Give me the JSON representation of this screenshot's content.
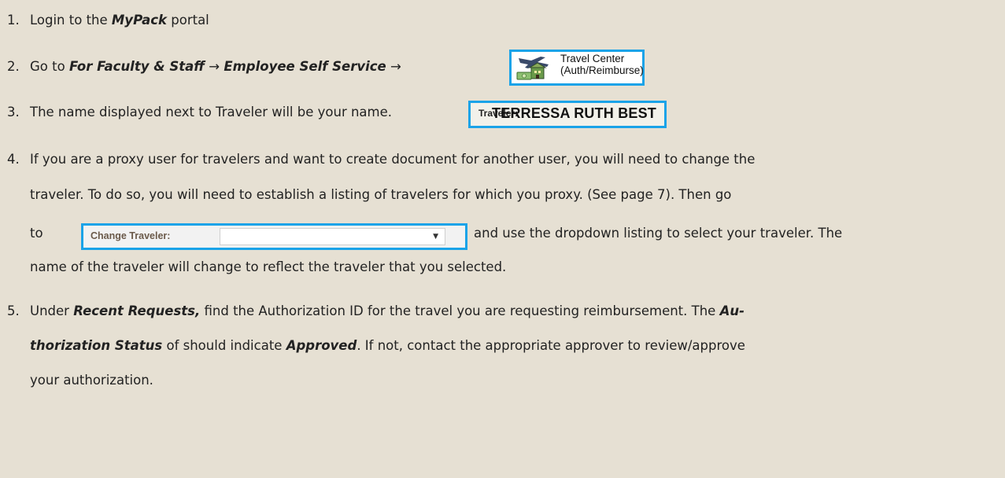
{
  "steps": {
    "s1": {
      "num": "1.",
      "a": "Login to the ",
      "b": "MyPack",
      "c": " portal"
    },
    "s2": {
      "num": "2.",
      "a": "Go to ",
      "b": "For Faculty & Staff",
      "arrow1": " → ",
      "c": "Employee Self Service",
      "arrow2": " →"
    },
    "s3": {
      "num": "3.",
      "a": "The name displayed next to Traveler will be your name."
    },
    "s4": {
      "num": "4.",
      "l1": "If you are a proxy user for travelers and want to create document for another user, you will need to change the",
      "l2": "traveler.  To do so, you will need to establish a listing of  travelers for which you proxy. (See page 7).  Then go",
      "l3a": "to",
      "l3b": "and use the dropdown listing to select your traveler.  The",
      "l4": "name of the traveler will change to reflect the traveler that you selected."
    },
    "s5": {
      "num": "5.",
      "l1a": "Under ",
      "l1b": "Recent Requests,",
      "l1c": " find the Authorization ID for the travel you are requesting reimbursement.  The ",
      "l1d": "Au-",
      "l2a": "thorization Status",
      "l2b": " of should indicate ",
      "l2c": "Approved",
      "l2d": ".  If not, contact the appropriate approver to review/approve",
      "l3": "your authorization."
    }
  },
  "travel_center": {
    "line1": "Travel Center",
    "line2": "(Auth/Reimburse)",
    "icon": "airplane-building-icon"
  },
  "traveler_box": {
    "label": "Traveler:",
    "name": "TERRESSA RUTH BEST"
  },
  "change_traveler": {
    "label": "Change Traveler:",
    "value": "",
    "icon": "dropdown-caret-icon"
  },
  "colors": {
    "background": "#e6e0d3",
    "highlight_border": "#1aa3e8"
  }
}
